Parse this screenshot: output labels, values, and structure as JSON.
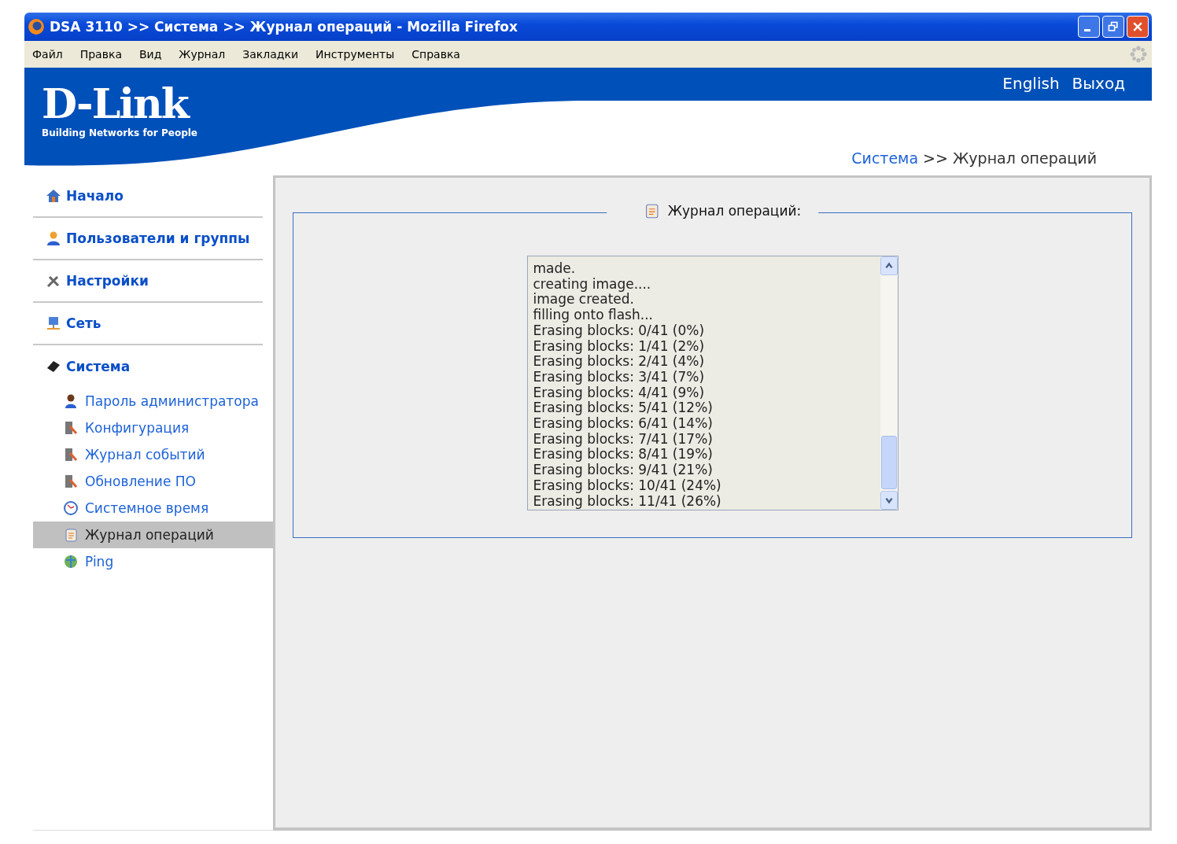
{
  "window": {
    "title": "DSA 3110 >> Система >> Журнал операций - Mozilla Firefox"
  },
  "menu": [
    "Файл",
    "Правка",
    "Вид",
    "Журнал",
    "Закладки",
    "Инструменты",
    "Справка"
  ],
  "header": {
    "logo": "D-Link",
    "tagline": "Building Networks for People",
    "links": [
      "English",
      "Выход"
    ]
  },
  "breadcrumb": {
    "parent": "Система",
    "separator": ">>",
    "current": "Журнал операций"
  },
  "sidebar": {
    "items": [
      {
        "label": "Начало",
        "selected": false
      },
      {
        "label": "Пользователи и группы",
        "selected": false
      },
      {
        "label": "Настройки",
        "selected": false
      },
      {
        "label": "Сеть",
        "selected": false
      },
      {
        "label": "Система",
        "selected": false,
        "children": [
          {
            "label": "Пароль администратора",
            "selected": false
          },
          {
            "label": "Конфигурация",
            "selected": false
          },
          {
            "label": "Журнал событий",
            "selected": false
          },
          {
            "label": "Обновление ПО",
            "selected": false
          },
          {
            "label": "Системное время",
            "selected": false
          },
          {
            "label": "Журнал операций",
            "selected": true
          },
          {
            "label": "Ping",
            "selected": false
          }
        ]
      }
    ]
  },
  "panel": {
    "title": "Журнал операций:",
    "log": [
      "made.",
      "creating image....",
      "image created.",
      "filling onto flash...",
      "Erasing blocks: 0/41 (0%)",
      "Erasing blocks: 1/41 (2%)",
      "Erasing blocks: 2/41 (4%)",
      "Erasing blocks: 3/41 (7%)",
      "Erasing blocks: 4/41 (9%)",
      "Erasing blocks: 5/41 (12%)",
      "Erasing blocks: 6/41 (14%)",
      "Erasing blocks: 7/41 (17%)",
      "Erasing blocks: 8/41 (19%)",
      "Erasing blocks: 9/41 (21%)",
      "Erasing blocks: 10/41 (24%)",
      "Erasing blocks: 11/41 (26%)"
    ]
  }
}
